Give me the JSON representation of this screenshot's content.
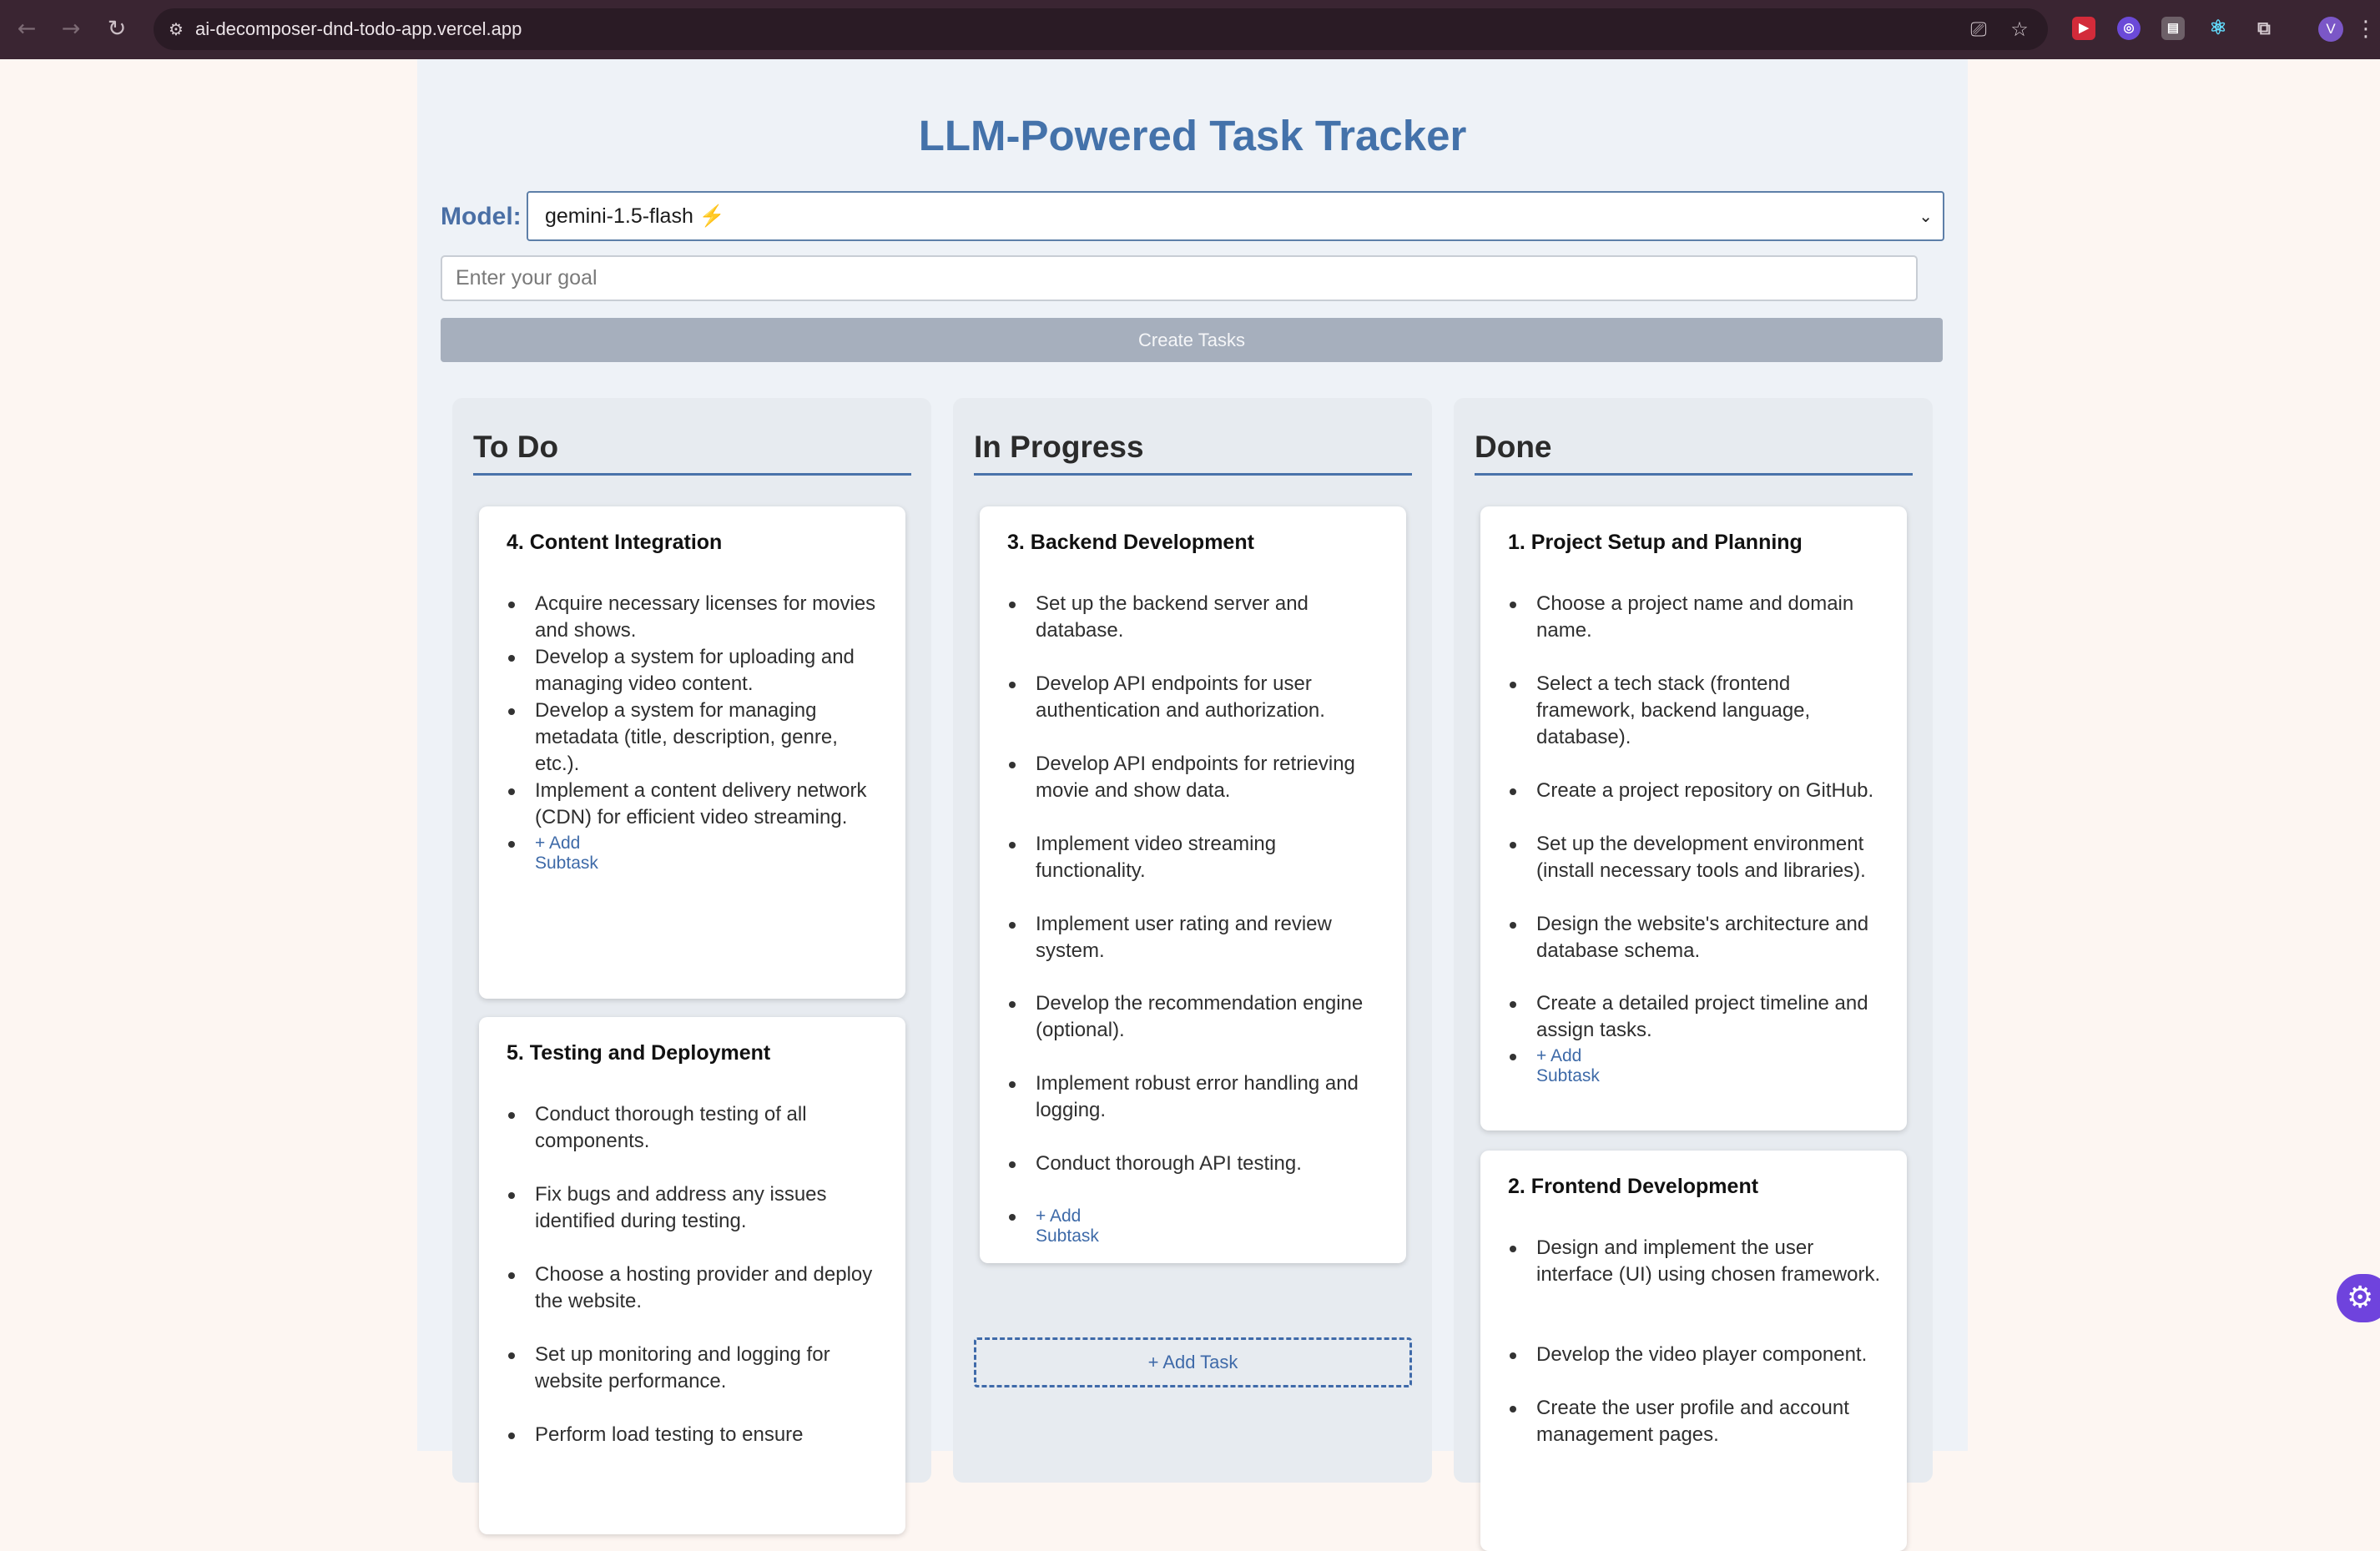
{
  "browser": {
    "url": "ai-decomposer-dnd-todo-app.vercel.app",
    "avatar_letter": "V"
  },
  "app": {
    "title": "LLM-Powered Task Tracker",
    "model_label": "Model:",
    "model_value": "gemini-1.5-flash",
    "goal_placeholder": "Enter your goal",
    "create_button": "Create Tasks",
    "add_task_label": "+ Add Task",
    "add_subtask_label": "+ Add Subtask"
  },
  "columns": {
    "todo": {
      "title": "To Do",
      "cards": [
        {
          "title": "4. Content Integration",
          "subtasks": [
            "Acquire necessary licenses for movies and shows.",
            "Develop a system for uploading and managing video content.",
            "Develop a system for managing metadata (title, description, genre, etc.).",
            "Implement a content delivery network (CDN) for efficient video streaming."
          ]
        },
        {
          "title": "5. Testing and Deployment",
          "subtasks": [
            "Conduct thorough testing of all components.",
            "Fix bugs and address any issues identified during testing.",
            "Choose a hosting provider and deploy the website.",
            "Set up monitoring and logging for website performance.",
            "Perform load testing to ensure"
          ]
        }
      ]
    },
    "inprogress": {
      "title": "In Progress",
      "cards": [
        {
          "title": "3. Backend Development",
          "subtasks": [
            "Set up the backend server and database.",
            "Develop API endpoints for user authentication and authorization.",
            "Develop API endpoints for retrieving movie and show data.",
            "Implement video streaming functionality.",
            "Implement user rating and review system.",
            "Develop the recommendation engine (optional).",
            "Implement robust error handling and logging.",
            "Conduct thorough API testing."
          ]
        }
      ]
    },
    "done": {
      "title": "Done",
      "cards": [
        {
          "title": "1. Project Setup and Planning",
          "subtasks": [
            "Choose a project name and domain name.",
            "Select a tech stack (frontend framework, backend language, database).",
            "Create a project repository on GitHub.",
            "Set up the development environment (install necessary tools and libraries).",
            "Design the website's architecture and database schema.",
            "Create a detailed project timeline and assign tasks."
          ]
        },
        {
          "title": "2. Frontend Development",
          "subtasks": [
            "Design and implement the user interface (UI) using chosen framework.",
            "Develop the video player component.",
            "Create the user profile and account management pages."
          ]
        }
      ]
    }
  },
  "icons": {
    "back": "arrow-left-icon",
    "forward": "arrow-right-icon",
    "reload": "reload-icon",
    "site_info": "site-info-icon",
    "install": "install-app-icon",
    "bookmark": "star-icon",
    "extensions": "puzzle-icon",
    "settings_fab": "gear-icon"
  },
  "colors": {
    "title": "#4472aa",
    "accent": "#3e6aa8",
    "chrome_bg": "#3a2532",
    "disabled_button": "#a6afbd"
  }
}
